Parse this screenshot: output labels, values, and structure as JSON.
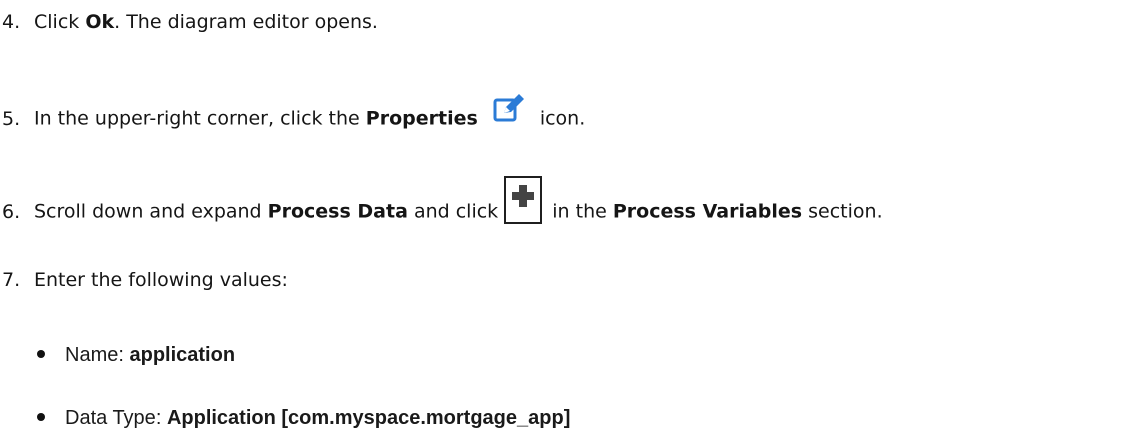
{
  "steps": [
    {
      "num": "4.",
      "pre": "Click ",
      "bold": "Ok",
      "post": ". The diagram editor opens."
    },
    {
      "num": "5.",
      "pre": "In the upper-right corner, click the ",
      "bold": "Properties",
      "post": " icon.",
      "icon": "edit-pencil-icon"
    },
    {
      "num": "6.",
      "pre": "Scroll down and expand ",
      "bold": "Process Data",
      "mid": " and click ",
      "icon": "plus-icon",
      "post_pre": " in the ",
      "bold2": "Process Variables",
      "post": " section."
    },
    {
      "num": "7.",
      "text": "Enter the following values:"
    }
  ],
  "values": [
    {
      "label": "Name",
      "sep": ": ",
      "value": "application"
    },
    {
      "label": "Data Type",
      "sep": ": ",
      "value": "Application [com.myspace.mortgage_app]"
    }
  ],
  "colors": {
    "text": "#151515",
    "icon_blue": "#2b7bd6"
  }
}
